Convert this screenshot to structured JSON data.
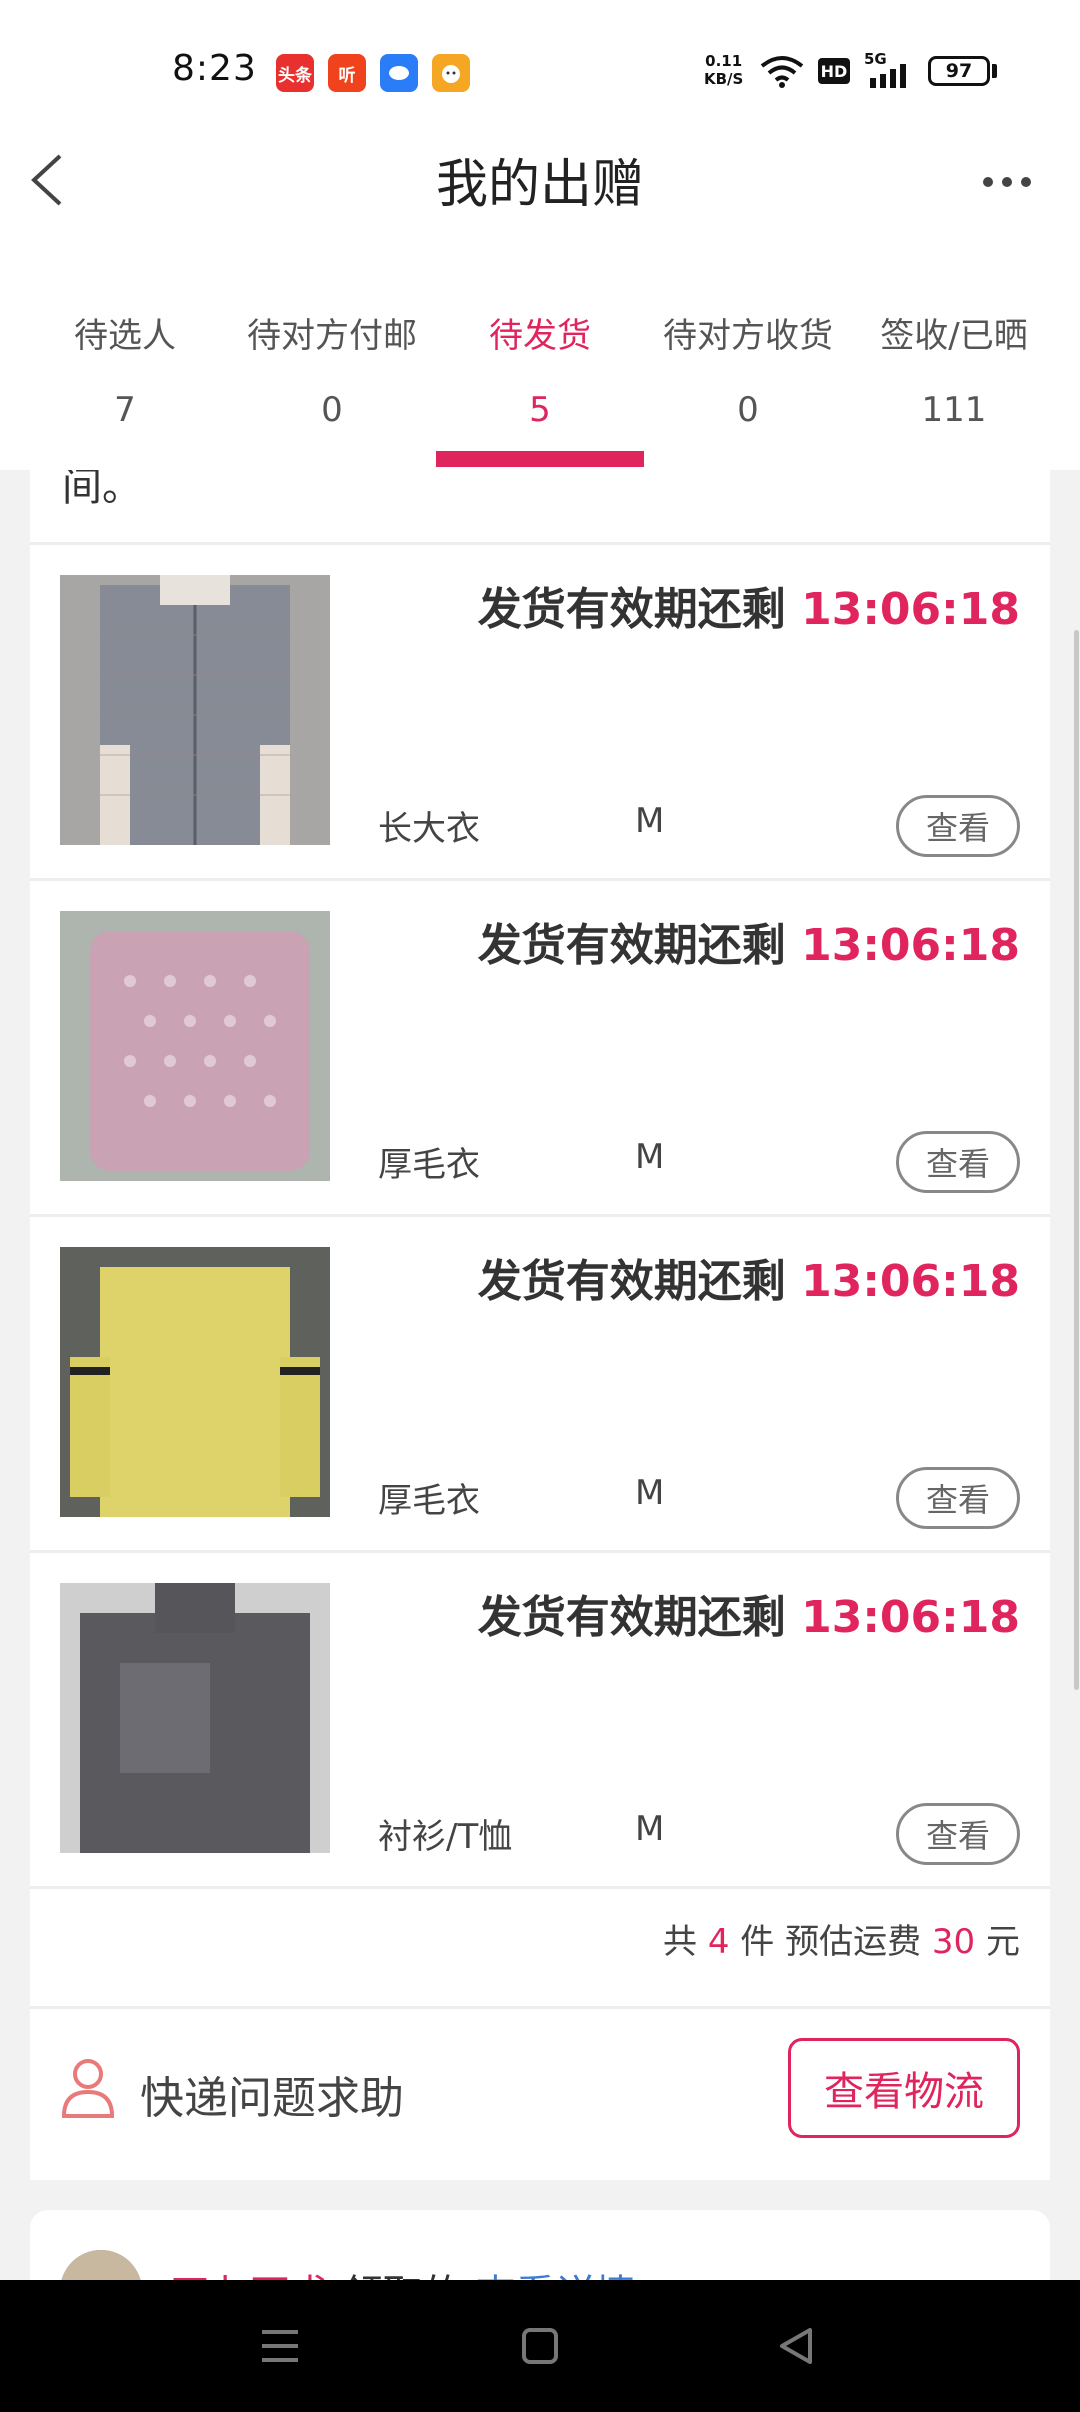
{
  "status_bar": {
    "time": "8:23",
    "app_icons": [
      {
        "name": "toutiao-app-icon",
        "text": "头条",
        "color": "#e8312f"
      },
      {
        "name": "ting-app-icon",
        "text": "听",
        "color": "#f0421c"
      },
      {
        "name": "messaging-app-icon",
        "text": "",
        "color": "#2a7cf7"
      },
      {
        "name": "mascot-app-icon",
        "text": "",
        "color": "#f5a623"
      }
    ],
    "net_speed_value": "0.11",
    "net_speed_unit": "KB/S",
    "hd_label": "HD",
    "signal_label": "5G",
    "battery_level": "97"
  },
  "header": {
    "title": "我的出赠",
    "back_icon": "chevron-left-icon",
    "more_icon": "more-dots-icon"
  },
  "tabs": [
    {
      "label": "待选人",
      "count": "7",
      "active": false
    },
    {
      "label": "待对方付邮",
      "count": "0",
      "active": false
    },
    {
      "label": "待发货",
      "count": "5",
      "active": true
    },
    {
      "label": "待对方收货",
      "count": "0",
      "active": false
    },
    {
      "label": "签收/已晒",
      "count": "111",
      "active": false
    }
  ],
  "partial_text": "间。",
  "items": [
    {
      "deadline_label": "发货有效期还剩",
      "deadline_time": "13:06:18",
      "name": "长大衣",
      "size": "M",
      "view_label": "查看",
      "image_color": "#8c8f98"
    },
    {
      "deadline_label": "发货有效期还剩",
      "deadline_time": "13:06:18",
      "name": "厚毛衣",
      "size": "M",
      "view_label": "查看",
      "image_color": "#c9a3b3"
    },
    {
      "deadline_label": "发货有效期还剩",
      "deadline_time": "13:06:18",
      "name": "厚毛衣",
      "size": "M",
      "view_label": "查看",
      "image_color": "#ddd36a"
    },
    {
      "deadline_label": "发货有效期还剩",
      "deadline_time": "13:06:18",
      "name": "衬衫/T恤",
      "size": "M",
      "view_label": "查看",
      "image_color": "#5a5a5e"
    }
  ],
  "summary": {
    "prefix": "共",
    "count": "4",
    "count_unit": "件",
    "shipping_label": "预估运费",
    "shipping_value": "30",
    "currency": "元"
  },
  "help": {
    "icon": "user-icon",
    "label": "快递问题求助",
    "logistics_button": "查看物流"
  },
  "next_card": {
    "name": "四七不求",
    "action": "领取的",
    "link": "查看详情"
  },
  "colors": {
    "accent": "#e0245e",
    "link": "#3a7bd5"
  }
}
